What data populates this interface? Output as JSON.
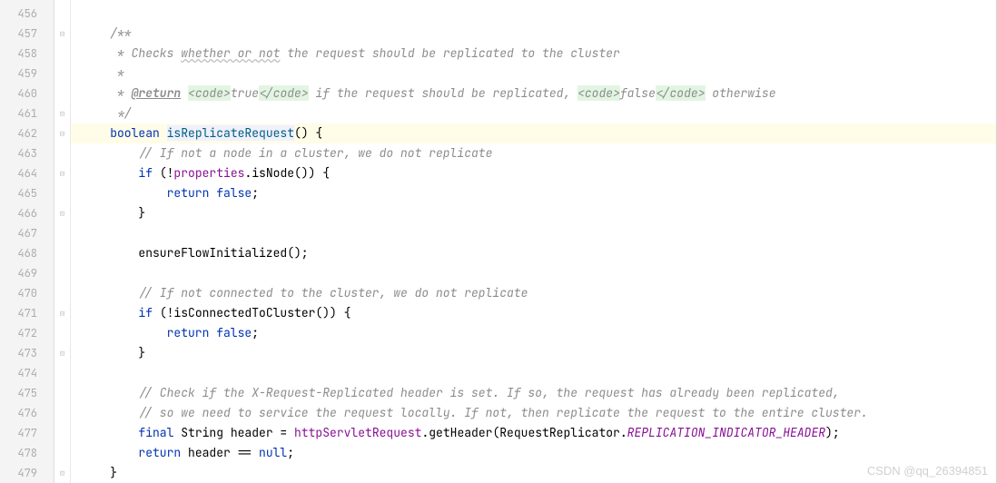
{
  "line_start": 456,
  "line_end": 479,
  "highlighted_line": 462,
  "code_lines": [
    {
      "n": 456,
      "fold": "",
      "html": ""
    },
    {
      "n": 457,
      "fold": "open",
      "html": "    <span class='doc'>/**</span>"
    },
    {
      "n": 458,
      "fold": "",
      "html": "    <span class='doc'> * Checks </span><span class='doc underline-wavy'>whether or not</span><span class='doc'> the request should be replicated to the cluster</span>"
    },
    {
      "n": 459,
      "fold": "",
      "html": "    <span class='doc'> *</span>"
    },
    {
      "n": 460,
      "fold": "",
      "html": "    <span class='doc'> * </span><span class='doc-tag'>@return</span><span class='doc'> </span><span class='doc-markup'>&lt;code&gt;</span><span class='doc'>true</span><span class='doc-markup'>&lt;/code&gt;</span><span class='doc'> if the request should be replicated, </span><span class='doc-markup'>&lt;code&gt;</span><span class='doc'>false</span><span class='doc-markup'>&lt;/code&gt;</span><span class='doc'> otherwise</span>"
    },
    {
      "n": 461,
      "fold": "close",
      "html": "    <span class='doc'> */</span>"
    },
    {
      "n": 462,
      "fold": "open",
      "html": "    <span class='kw'>boolean</span> <span class='method' style='background:#f0f0ff;'>isReplicateRequest</span>() {"
    },
    {
      "n": 463,
      "fold": "",
      "html": "        <span class='comment'>// If not a node in a cluster, we do not replicate</span>"
    },
    {
      "n": 464,
      "fold": "open",
      "html": "        <span class='kw'>if</span> (!<span class='field'>properties</span>.isNode()) {"
    },
    {
      "n": 465,
      "fold": "",
      "html": "            <span class='kw'>return false</span>;"
    },
    {
      "n": 466,
      "fold": "close",
      "html": "        }"
    },
    {
      "n": 467,
      "fold": "",
      "html": ""
    },
    {
      "n": 468,
      "fold": "",
      "html": "        ensureFlowInitialized();"
    },
    {
      "n": 469,
      "fold": "",
      "html": ""
    },
    {
      "n": 470,
      "fold": "",
      "html": "        <span class='comment'>// If not connected to the cluster, we do not replicate</span>"
    },
    {
      "n": 471,
      "fold": "open",
      "html": "        <span class='kw'>if</span> (!isConnectedToCluster()) {"
    },
    {
      "n": 472,
      "fold": "",
      "html": "            <span class='kw'>return false</span>;"
    },
    {
      "n": 473,
      "fold": "close",
      "html": "        }"
    },
    {
      "n": 474,
      "fold": "",
      "html": ""
    },
    {
      "n": 475,
      "fold": "",
      "html": "        <span class='comment'>// Check if the X-Request-Replicated header is set. If so, the request has already been replicated,</span>"
    },
    {
      "n": 476,
      "fold": "",
      "html": "        <span class='comment'>// so we need to service the request locally. If not, then replicate the request to the entire cluster.</span>"
    },
    {
      "n": 477,
      "fold": "",
      "html": "        <span class='kw'>final</span> String header = <span class='field'>httpServletRequest</span>.getHeader(RequestReplicator.<span class='const'>REPLICATION_INDICATOR_HEADER</span>);"
    },
    {
      "n": 478,
      "fold": "",
      "html": "        <span class='kw'>return</span> header == <span class='kw'>null</span>;"
    },
    {
      "n": 479,
      "fold": "close",
      "html": "    }"
    }
  ],
  "watermark": "CSDN @qq_26394851"
}
